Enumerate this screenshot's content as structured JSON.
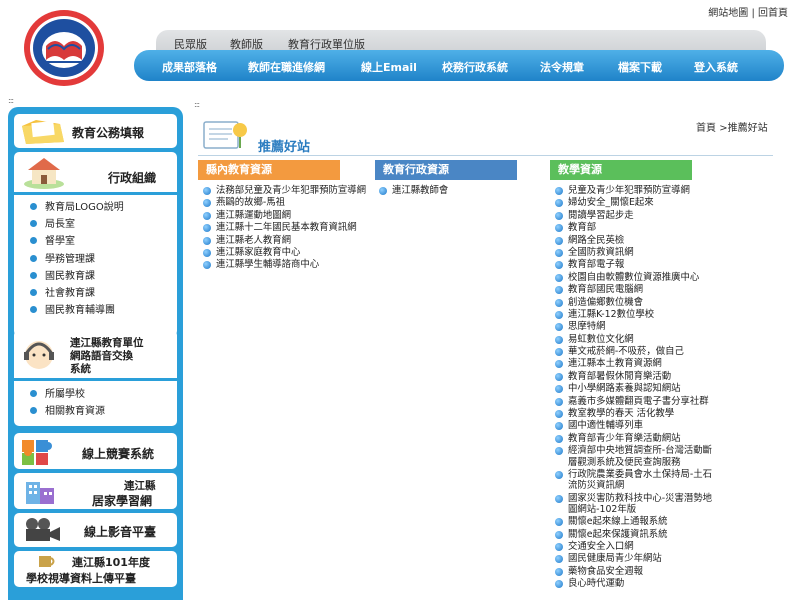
{
  "header": {
    "top_links": [
      "網站地圖",
      "回首頁"
    ],
    "top_links_sep": "|",
    "tabs": [
      "民眾版",
      "教師版",
      "教育行政單位版"
    ],
    "nav": [
      "成果部落格",
      "教師在職進修網",
      "線上Email",
      "校務行政系統",
      "法令規章",
      "檔案下載",
      "登入系統"
    ],
    "dots": ":::"
  },
  "sidebar": {
    "box1_title": "教育公務填報",
    "box2_title": "行政組織",
    "org_items": [
      "教育局LOGO說明",
      "局長室",
      "督學室",
      "學務管理課",
      "國民教育課",
      "社會教育課",
      "國民教育輔導團"
    ],
    "box3_title_line1": "連江縣教育單位",
    "box3_title_line2": "網路語音交換",
    "box3_title_line3": "系統",
    "link_items": [
      "所屬學校",
      "相關教育資源"
    ],
    "banner_contest": "線上競賽系統",
    "banner_learn_line1": "連江縣",
    "banner_learn_line2": "居家學習網",
    "banner_video": "線上影音平臺",
    "banner_upload_line1": "連江縣101年度",
    "banner_upload_line2": "學校視導資料上傳平臺"
  },
  "main": {
    "breadcrumb_home": "首頁",
    "breadcrumb_current": ">推薦好站",
    "title": "推薦好站",
    "columns": [
      {
        "heading": "縣內教育資源",
        "color": "#f39a3f",
        "items": [
          "法務部兒童及青少年犯罪預防宣導網",
          "燕鷗的故鄉-馬祖",
          "連江縣運動地圖網",
          "連江縣十二年國民基本教育資訊網",
          "連江縣老人教育網",
          "連江縣家庭教育中心",
          "連江縣學生輔導諮商中心"
        ]
      },
      {
        "heading": "教育行政資源",
        "color": "#4a86c5",
        "items": [
          "連江縣教師會"
        ]
      },
      {
        "heading": "教學資源",
        "color": "#5bbf5b",
        "items": [
          "兒童及青少年犯罪預防宣導網",
          "婦幼安全_關懷E起來",
          "閱讀學習起步走",
          "教育部",
          "網路全民英檢",
          "全國防救資訊網",
          "教育部電子報",
          "校園自由軟體數位資源推廣中心",
          "教育部國民電腦網",
          "創造偏鄉數位機會",
          "連江縣K-12數位學校",
          "思摩特網",
          "易虹數位文化網",
          "華文戒菸網-不吸菸，做自己",
          "連江縣本土教育資源網",
          "教育部暑假休閒育樂活動",
          "中小學網路素養與認知網站",
          "嘉義市多媒體翻頁電子書分享社群",
          "教室教學的春天 活化教學",
          "國中適性輔導列車",
          "教育部青少年育樂活動網站",
          "經濟部中央地質調查所-台灣活動斷層觀測系統及便民查詢服務",
          "行政院農業委員會水土保持局-土石流防災資訊網",
          "國家災害防救科技中心-災害潛勢地圖網站-102年版",
          "關懷e起來線上通報系統",
          "關懷e起來保護資訊系統",
          "交通安全入口網",
          "國民健康局青少年網站",
          "藥物食品安全週報",
          "良心時代運動"
        ]
      }
    ]
  },
  "colors": {
    "sidebar": "#2a9fd9",
    "nav": "#1f83c9",
    "title": "#2a7cc0"
  },
  "icons": [
    "emblem-logo",
    "folder-icon",
    "house-icon",
    "headset-person-icon",
    "puzzle-icon",
    "building-icon",
    "camera-icon",
    "cup-icon",
    "notepad-icon"
  ]
}
